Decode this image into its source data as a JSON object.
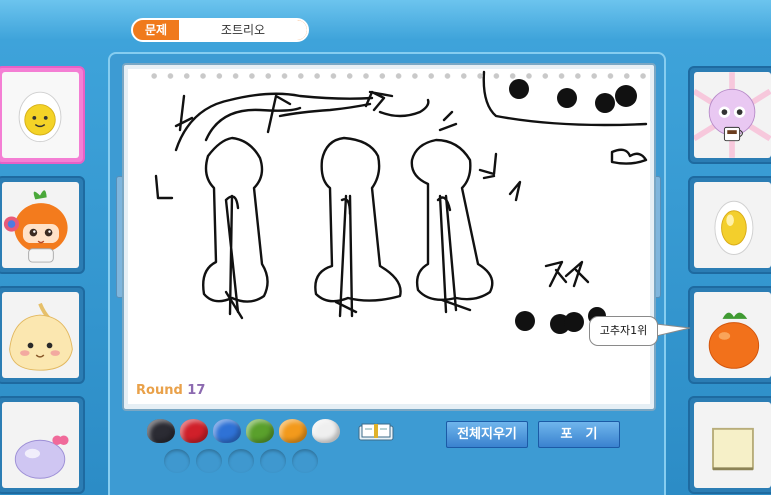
{
  "question": {
    "tag": "문제",
    "answer": "조트리오"
  },
  "round": {
    "label": "Round",
    "number": "17"
  },
  "speech_bubble": "고추자1위",
  "buttons": {
    "clear_all": "전체지우기",
    "give_up": "포　기"
  },
  "palette": {
    "colors": [
      "#2b2b33",
      "#d0202a",
      "#2f72d6",
      "#5aa02c",
      "#f39a1c",
      "#efefef"
    ],
    "empty_slots": 5
  },
  "players_left": [
    {
      "avatar": "egg-face-avatar",
      "active": true
    },
    {
      "avatar": "carrot-girl-avatar",
      "active": false
    },
    {
      "avatar": "onion-dumpling-avatar",
      "active": false
    },
    {
      "avatar": "purple-blob-avatar",
      "active": false
    }
  ],
  "players_right": [
    {
      "avatar": "pink-sheep-coffee-avatar"
    },
    {
      "avatar": "fried-egg-avatar"
    },
    {
      "avatar": "tangerine-avatar"
    },
    {
      "avatar": "tofu-block-avatar"
    }
  ]
}
